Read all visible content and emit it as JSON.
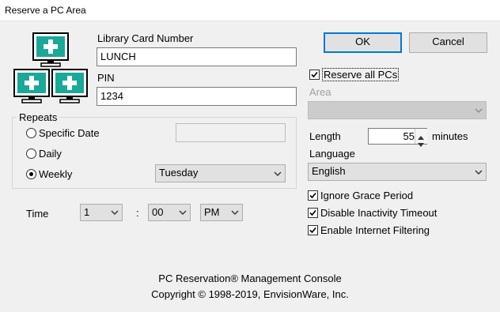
{
  "window": {
    "title": "Reserve a PC Area"
  },
  "patron": {
    "card_label": "Library Card Number",
    "card_value": "LUNCH",
    "pin_label": "PIN",
    "pin_value": "1234"
  },
  "buttons": {
    "ok": "OK",
    "cancel": "Cancel"
  },
  "options": {
    "reserve_all_label": "Reserve all PCs",
    "reserve_all_checked": true,
    "area_label": "Area",
    "area_value": "",
    "length_label": "Length",
    "length_value": "55",
    "length_unit": "minutes",
    "language_label": "Language",
    "language_value": "English",
    "ignore_grace_label": "Ignore Grace Period",
    "disable_inactivity_label": "Disable Inactivity Timeout",
    "enable_filtering_label": "Enable Internet Filtering"
  },
  "repeats": {
    "legend": "Repeats",
    "specific_date_label": "Specific Date",
    "specific_date_value": "",
    "daily_label": "Daily",
    "weekly_label": "Weekly",
    "selected": "Weekly",
    "weekday_value": "Tuesday"
  },
  "time": {
    "label": "Time",
    "hour": "1",
    "separator": ":",
    "minute": "00",
    "ampm": "PM"
  },
  "footer": {
    "line1": "PC Reservation® Management Console",
    "line2": "Copyright © 1998-2019, EnvisionWare, Inc."
  },
  "colors": {
    "accent": "#0078d7",
    "monitor_screen": "#1aa898"
  },
  "icons": {
    "app_logo": "three-monitors-plus-icon"
  }
}
